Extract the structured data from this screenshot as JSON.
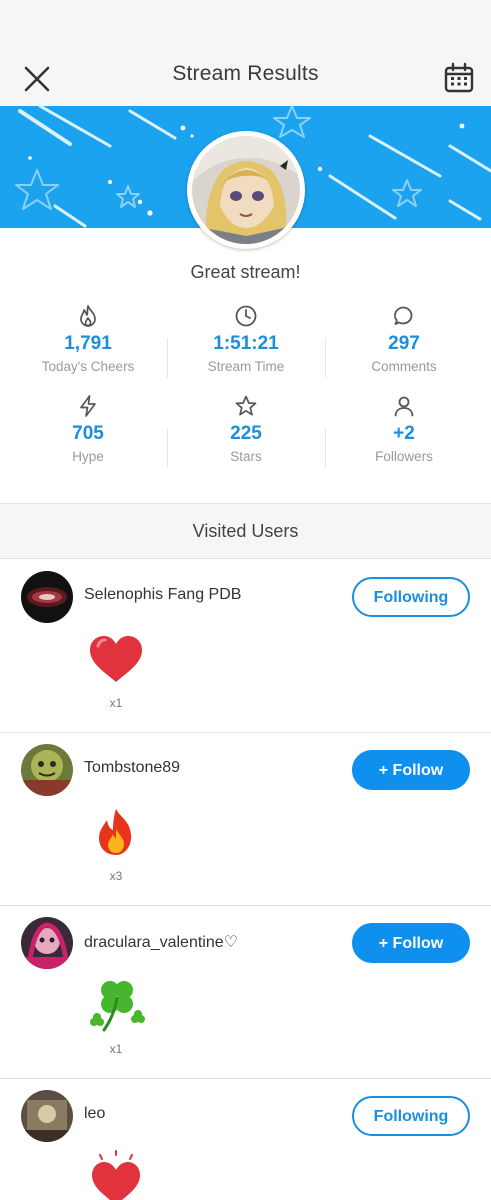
{
  "header": {
    "title": "Stream Results"
  },
  "banner": {
    "accent": "#1ba3ef"
  },
  "profile": {
    "headline": "Great stream!"
  },
  "stats": [
    {
      "icon": "flame-icon",
      "value": "1,791",
      "label": "Today's Cheers"
    },
    {
      "icon": "clock-icon",
      "value": "1:51:21",
      "label": "Stream Time"
    },
    {
      "icon": "chat-bubble-icon",
      "value": "297",
      "label": "Comments"
    },
    {
      "icon": "lightning-icon",
      "value": "705",
      "label": "Hype"
    },
    {
      "icon": "star-icon",
      "value": "225",
      "label": "Stars"
    },
    {
      "icon": "person-icon",
      "value": "+2",
      "label": "Followers"
    }
  ],
  "visited": {
    "title": "Visited Users",
    "users": [
      {
        "name": "Selenophis Fang PDB",
        "button": "Following",
        "gift": "heart",
        "count": "x1"
      },
      {
        "name": "Tombstone89",
        "button": "+ Follow",
        "gift": "fire",
        "count": "x3"
      },
      {
        "name": "draculara_valentine♡",
        "button": "+ Follow",
        "gift": "clover",
        "count": "x1"
      },
      {
        "name": "leo",
        "button": "Following",
        "gift": "heart",
        "count": ""
      }
    ]
  }
}
